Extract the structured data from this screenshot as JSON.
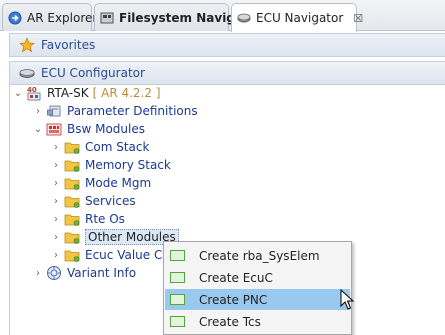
{
  "tabs": [
    {
      "label": "AR Explorer",
      "icon": "explorer-arrow-icon",
      "active": false
    },
    {
      "label": "Filesystem Navigator",
      "icon": "filesystem-icon",
      "active": false
    },
    {
      "label": "ECU Navigator",
      "icon": "ecu-navigator-icon",
      "active": true,
      "close": "☒"
    }
  ],
  "sections": {
    "favorites": "Favorites",
    "ecu_configurator": "ECU Configurator"
  },
  "tree": {
    "root": {
      "label": "RTA-SK",
      "suffix": "[ AR 4.2.2 ]"
    },
    "parameter_definitions": "Parameter Definitions",
    "bsw_modules": "Bsw Modules",
    "com_stack": "Com Stack",
    "memory_stack": "Memory Stack",
    "mode_mgm": "Mode Mgm",
    "services": "Services",
    "rte_os": "Rte Os",
    "other_modules": "Other Modules",
    "ecuc_value_coll": "Ecuc Value Coll",
    "variant_info": "Variant Info"
  },
  "context_menu": {
    "items": [
      {
        "label": "Create rba_SysElem",
        "hover": false
      },
      {
        "label": "Create EcuC",
        "hover": false
      },
      {
        "label": "Create PNC",
        "hover": true
      },
      {
        "label": "Create Tcs",
        "hover": false
      }
    ]
  },
  "colors": {
    "tree_label": "#1b3a8f",
    "section_text": "#2a4b8d",
    "menu_hover": "#99c9ef",
    "folder": "#f4c542"
  }
}
